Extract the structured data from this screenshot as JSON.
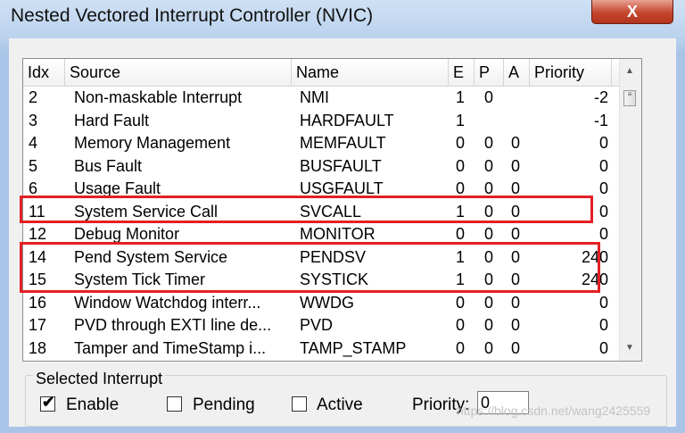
{
  "window": {
    "title": "Nested Vectored Interrupt Controller (NVIC)",
    "close_glyph": "X"
  },
  "table": {
    "headers": {
      "idx": "Idx",
      "source": "Source",
      "name": "Name",
      "e": "E",
      "p": "P",
      "a": "A",
      "priority": "Priority"
    },
    "rows": [
      {
        "idx": "2",
        "source": "Non-maskable Interrupt",
        "name": "NMI",
        "e": "1",
        "p": "0",
        "a": "",
        "priority": "-2"
      },
      {
        "idx": "3",
        "source": "Hard Fault",
        "name": "HARDFAULT",
        "e": "1",
        "p": "",
        "a": "",
        "priority": "-1"
      },
      {
        "idx": "4",
        "source": "Memory Management",
        "name": "MEMFAULT",
        "e": "0",
        "p": "0",
        "a": "0",
        "priority": "0"
      },
      {
        "idx": "5",
        "source": "Bus Fault",
        "name": "BUSFAULT",
        "e": "0",
        "p": "0",
        "a": "0",
        "priority": "0"
      },
      {
        "idx": "6",
        "source": "Usage Fault",
        "name": "USGFAULT",
        "e": "0",
        "p": "0",
        "a": "0",
        "priority": "0"
      },
      {
        "idx": "11",
        "source": "System Service Call",
        "name": "SVCALL",
        "e": "1",
        "p": "0",
        "a": "0",
        "priority": "0"
      },
      {
        "idx": "12",
        "source": "Debug Monitor",
        "name": "MONITOR",
        "e": "0",
        "p": "0",
        "a": "0",
        "priority": "0"
      },
      {
        "idx": "14",
        "source": "Pend System Service",
        "name": "PENDSV",
        "e": "1",
        "p": "0",
        "a": "0",
        "priority": "240"
      },
      {
        "idx": "15",
        "source": "System Tick Timer",
        "name": "SYSTICK",
        "e": "1",
        "p": "0",
        "a": "0",
        "priority": "240"
      },
      {
        "idx": "16",
        "source": "Window Watchdog interr...",
        "name": "WWDG",
        "e": "0",
        "p": "0",
        "a": "0",
        "priority": "0"
      },
      {
        "idx": "17",
        "source": "PVD through EXTI line de...",
        "name": "PVD",
        "e": "0",
        "p": "0",
        "a": "0",
        "priority": "0"
      },
      {
        "idx": "18",
        "source": "Tamper and TimeStamp i...",
        "name": "TAMP_STAMP",
        "e": "0",
        "p": "0",
        "a": "0",
        "priority": "0"
      }
    ],
    "highlight_color": "#e32024"
  },
  "selected": {
    "legend": "Selected Interrupt",
    "enable_label": "Enable",
    "enable_checked": true,
    "check_glyph": "✔",
    "pending_label": "Pending",
    "pending_checked": false,
    "active_label": "Active",
    "active_checked": false,
    "priority_label": "Priority:",
    "priority_value": "0"
  },
  "watermark": "https://blog.csdn.net/wang2425559"
}
